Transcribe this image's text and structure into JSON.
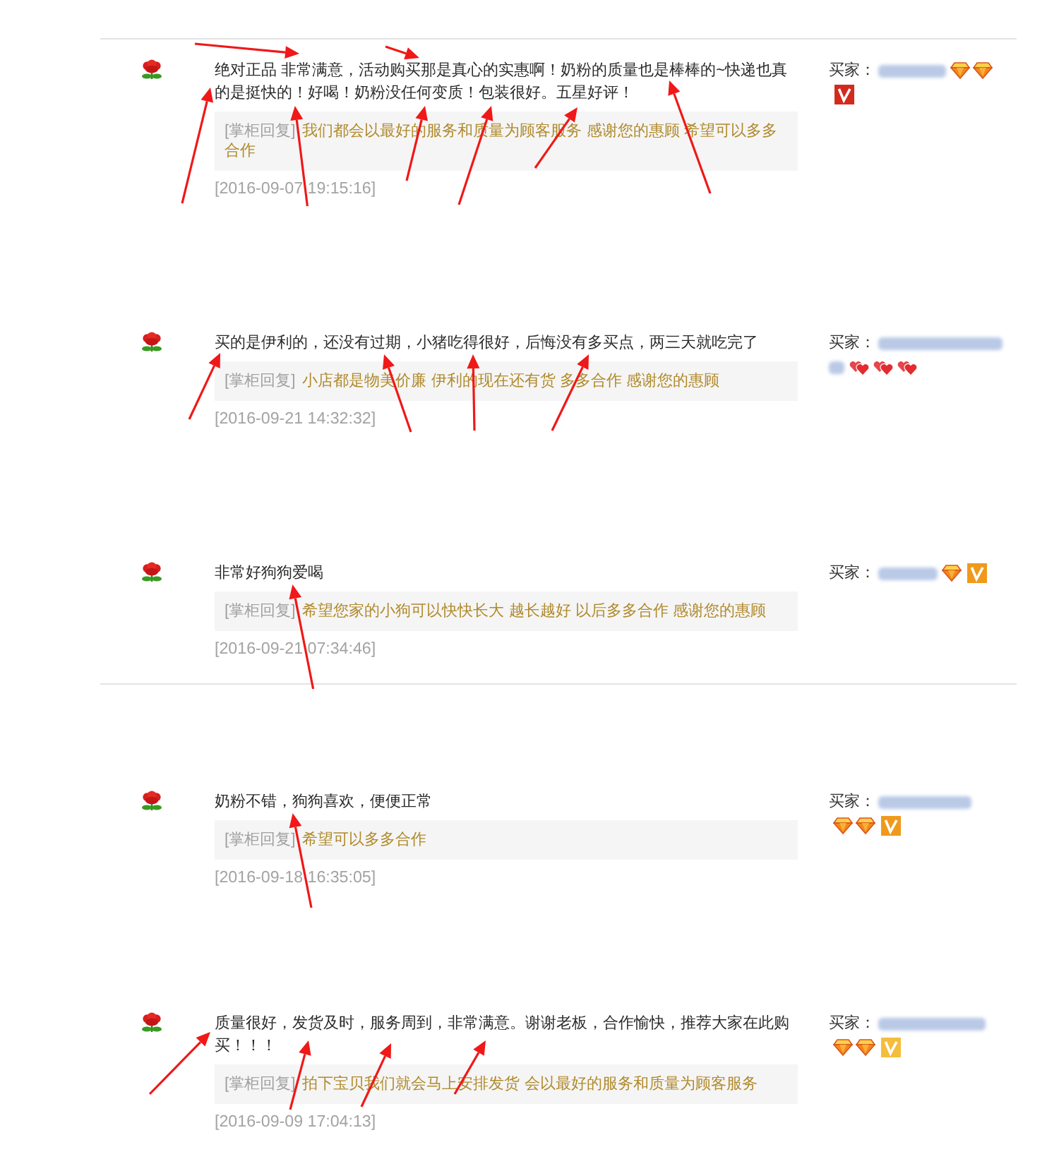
{
  "sections": [
    {
      "reviews": [
        {
          "text": "绝对正品 非常满意，活动购买那是真心的实惠啊！奶粉的质量也是棒棒的~快递也真的是挺快的！好喝！奶粉没任何变质！包装很好。五星好评！",
          "reply": {
            "label": "[掌柜回复]",
            "text": "我们都会以最好的服务和质量为顾客服务 感谢您的惠顾 希望可以多多合作"
          },
          "date": "[2016-09-07 19:15:16]",
          "buyer": {
            "label": "买家：",
            "name_masked": true,
            "rank_icons": [
              {
                "kind": "diamond"
              },
              {
                "kind": "diamond"
              }
            ],
            "tag": {
              "color": "#d42a1e"
            }
          }
        },
        {
          "text": "买的是伊利的，还没有过期，小猪吃得很好，后悔没有多买点，两三天就吃完了",
          "reply": {
            "label": "[掌柜回复]",
            "text": "小店都是物美价廉 伊利的现在还有货 多多合作 感谢您的惠顾"
          },
          "date": "[2016-09-21 14:32:32]",
          "buyer": {
            "label": "买家：",
            "name_masked": true,
            "rank_icons": [
              {
                "kind": "heart"
              },
              {
                "kind": "heart"
              },
              {
                "kind": "heart"
              }
            ]
          }
        },
        {
          "text": "非常好狗狗爱喝",
          "reply": {
            "label": "[掌柜回复]",
            "text": "希望您家的小狗可以快快长大 越长越好 以后多多合作 感谢您的惠顾"
          },
          "date": "[2016-09-21 07:34:46]",
          "buyer": {
            "label": "买家：",
            "name_masked": true,
            "rank_icons": [
              {
                "kind": "diamond"
              }
            ],
            "tag": {
              "color": "#ef9a1c"
            }
          }
        }
      ]
    },
    {
      "reviews": [
        {
          "text": "奶粉不错，狗狗喜欢，便便正常",
          "reply": {
            "label": "[掌柜回复]",
            "text": "希望可以多多合作"
          },
          "date": "[2016-09-18 16:35:05]",
          "buyer": {
            "label": "买家：",
            "name_masked": true,
            "rank_icons": [
              {
                "kind": "diamond"
              },
              {
                "kind": "diamond"
              }
            ],
            "tag": {
              "color": "#ef9a1c"
            }
          }
        },
        {
          "text": "质量很好，发货及时，服务周到，非常满意。谢谢老板，合作愉快，推荐大家在此购买！！！",
          "reply": {
            "label": "[掌柜回复]",
            "text": "拍下宝贝我们就会马上安排发货 会以最好的服务和质量为顾客服务"
          },
          "date": "[2016-09-09 17:04:13]",
          "buyer": {
            "label": "买家：",
            "name_masked": true,
            "rank_icons": [
              {
                "kind": "diamond"
              },
              {
                "kind": "diamond"
              }
            ],
            "tag": {
              "color": "#f5bd3c"
            }
          }
        }
      ]
    }
  ]
}
